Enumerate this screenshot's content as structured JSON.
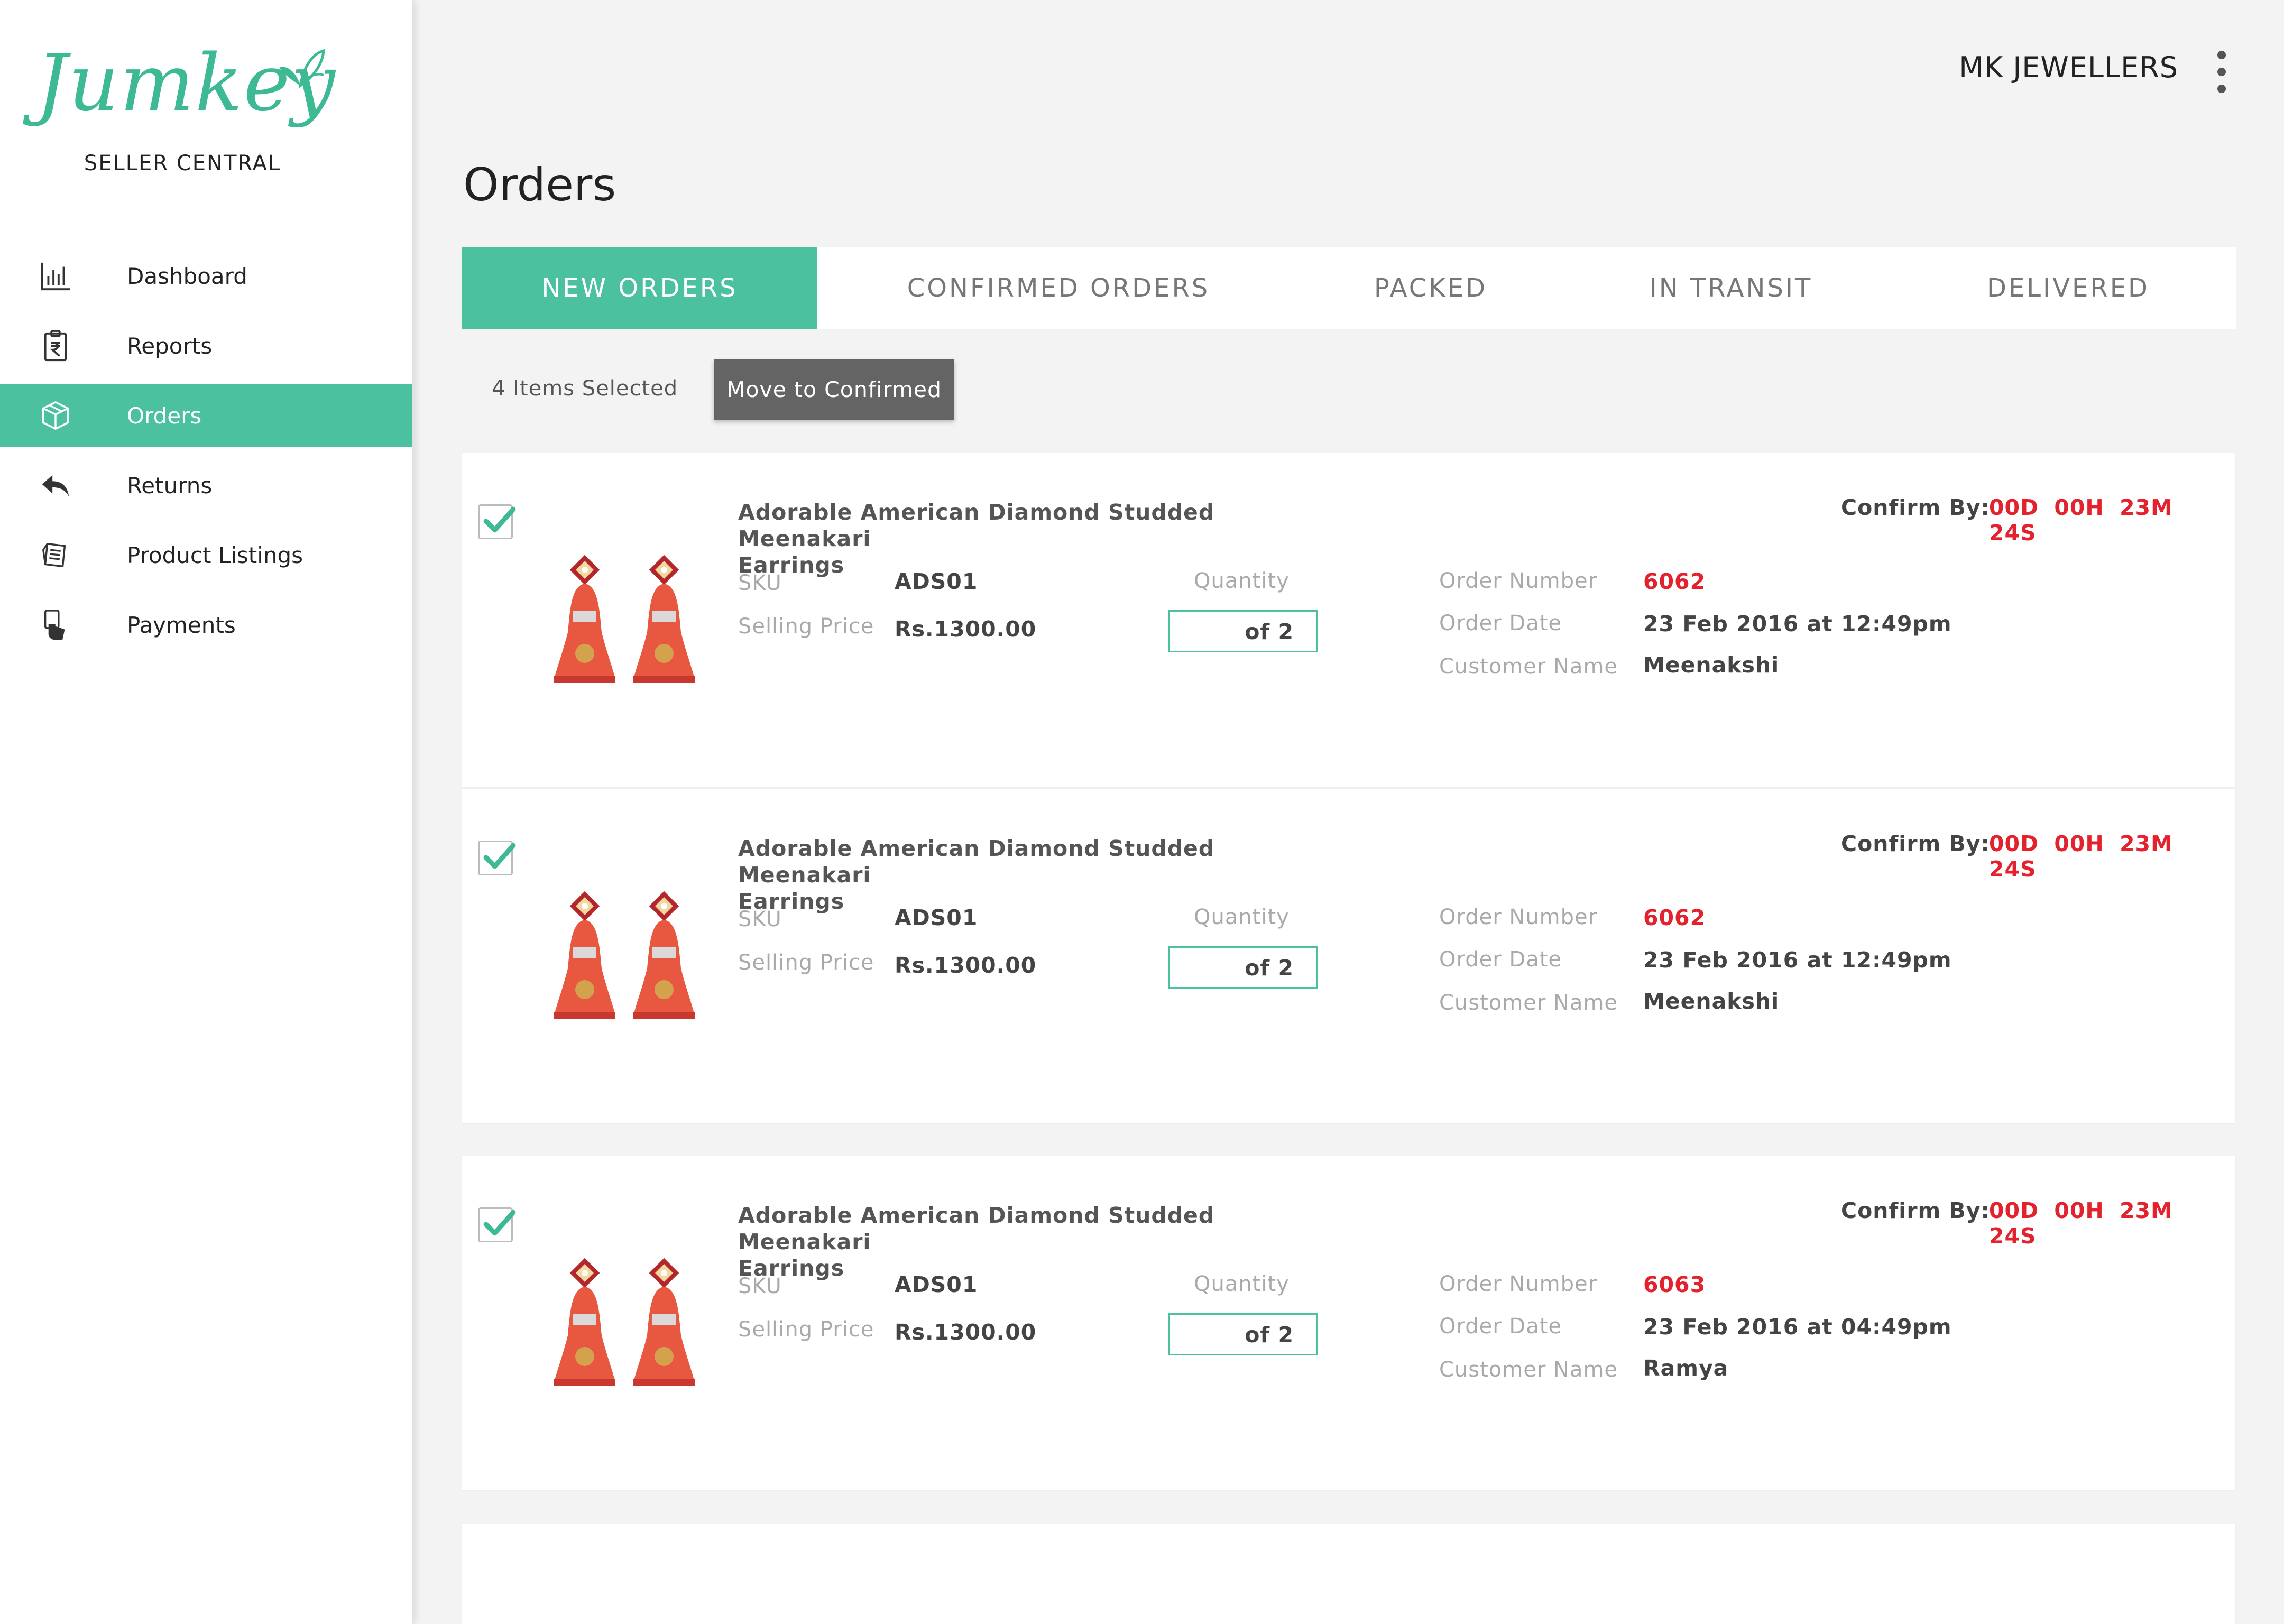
{
  "brand": {
    "logo_text": "Jumkey",
    "subtitle": "SELLER CENTRAL",
    "accent_color": "#4bc19f",
    "alert_color": "#e3222d"
  },
  "sidebar": {
    "items": [
      {
        "label": "Dashboard",
        "icon": "bar-chart-icon",
        "active": false
      },
      {
        "label": "Reports",
        "icon": "rupee-clipboard-icon",
        "active": false
      },
      {
        "label": "Orders",
        "icon": "package-box-icon",
        "active": true
      },
      {
        "label": "Returns",
        "icon": "reply-arrow-icon",
        "active": false
      },
      {
        "label": "Product Listings",
        "icon": "listing-tag-icon",
        "active": false
      },
      {
        "label": "Payments",
        "icon": "hand-card-icon",
        "active": false
      }
    ]
  },
  "header": {
    "store_name": "MK JEWELLERS",
    "menu_icon": "more-vertical-icon"
  },
  "page": {
    "title": "Orders"
  },
  "tabs": [
    {
      "label": "NEW ORDERS",
      "active": true
    },
    {
      "label": "CONFIRMED ORDERS",
      "active": false
    },
    {
      "label": "PACKED",
      "active": false
    },
    {
      "label": "IN TRANSIT",
      "active": false
    },
    {
      "label": "DELIVERED",
      "active": false
    }
  ],
  "toolbar": {
    "selected_count_text": "4 Items Selected",
    "move_button_label": "Move to Confirmed"
  },
  "labels": {
    "sku": "SKU",
    "selling_price": "Selling Price",
    "quantity": "Quantity",
    "order_number": "Order Number",
    "order_date": "Order Date",
    "customer_name": "Customer Name",
    "confirm_by": "Confirm By:"
  },
  "orders": [
    {
      "checked": true,
      "title_line1": "Adorable American Diamond Studded Meenakari",
      "title_line2": "Earrings",
      "sku": "ADS01",
      "selling_price": "Rs.1300.00",
      "quantity_text": "of 2",
      "order_number": "6062",
      "order_date": "23 Feb 2016 at 12:49pm",
      "customer_name": "Meenakshi",
      "confirm_by": "00D 00H 23M 24S"
    },
    {
      "checked": true,
      "title_line1": "Adorable American Diamond Studded Meenakari",
      "title_line2": "Earrings",
      "sku": "ADS01",
      "selling_price": "Rs.1300.00",
      "quantity_text": "of 2",
      "order_number": "6062",
      "order_date": "23 Feb 2016 at 12:49pm",
      "customer_name": "Meenakshi",
      "confirm_by": "00D 00H 23M 24S"
    },
    {
      "checked": true,
      "title_line1": "Adorable American Diamond Studded Meenakari",
      "title_line2": "Earrings",
      "sku": "ADS01",
      "selling_price": "Rs.1300.00",
      "quantity_text": "of 2",
      "order_number": "6063",
      "order_date": "23 Feb 2016 at 04:49pm",
      "customer_name": "Ramya",
      "confirm_by": "00D 00H 23M 24S"
    }
  ]
}
